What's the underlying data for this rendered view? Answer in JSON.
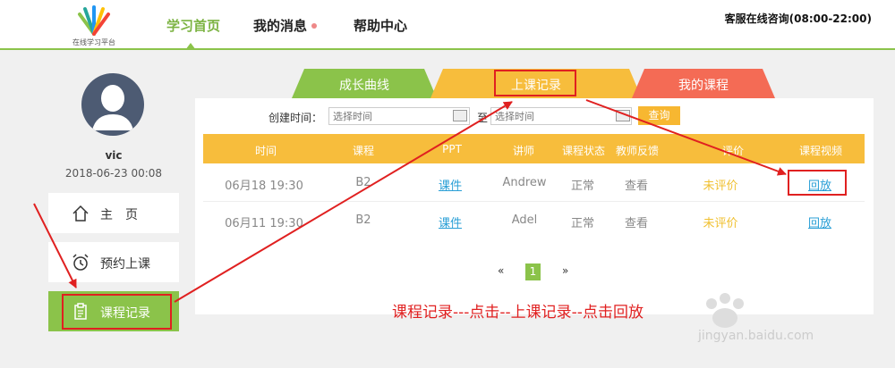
{
  "header": {
    "logo_text": "在线学习平台",
    "nav": [
      {
        "label": "学习首页",
        "active": true
      },
      {
        "label": "我的消息",
        "active": false
      },
      {
        "label": "帮助中心",
        "active": false
      }
    ],
    "service": "客服在线咨询(08:00-22:00)"
  },
  "user": {
    "name": "vic",
    "date": "2018-06-23 00:08"
  },
  "sidebar": {
    "items": [
      {
        "label": "主　页",
        "icon": "home-icon",
        "active": false
      },
      {
        "label": "预约上课",
        "icon": "alarm-clock-icon",
        "active": false
      },
      {
        "label": "课程记录",
        "icon": "clipboard-icon",
        "active": true
      }
    ]
  },
  "tabs": [
    {
      "label": "成长曲线",
      "color": "#8bc34a"
    },
    {
      "label": "上课记录",
      "color": "#f7bd3c"
    },
    {
      "label": "我的课程",
      "color": "#f46b55"
    }
  ],
  "filter": {
    "label": "创建时间：",
    "start_placeholder": "选择时间",
    "separator": "至",
    "end_placeholder": "选择时间",
    "query_button": "查询"
  },
  "table": {
    "columns": [
      "时间",
      "课程",
      "PPT",
      "讲师",
      "课程状态",
      "教师反馈",
      "评价",
      "课程视频"
    ],
    "rows": [
      {
        "time": "06月18 19:30",
        "course": "B2",
        "ppt": "课件",
        "teacher": "Andrew",
        "status": "正常",
        "feedback": "查看",
        "rating": "未评价",
        "video": "回放"
      },
      {
        "time": "06月11 19:30",
        "course": "B2",
        "ppt": "课件",
        "teacher": "Adel",
        "status": "正常",
        "feedback": "查看",
        "rating": "未评价",
        "video": "回放"
      }
    ]
  },
  "pagination": {
    "prev": "«",
    "current": "1",
    "next": "»"
  },
  "annotation": {
    "caption": "课程记录---点击--上课记录--点击回放",
    "color": "#e02020"
  },
  "watermark": {
    "text": "jingyan.baidu.com"
  }
}
